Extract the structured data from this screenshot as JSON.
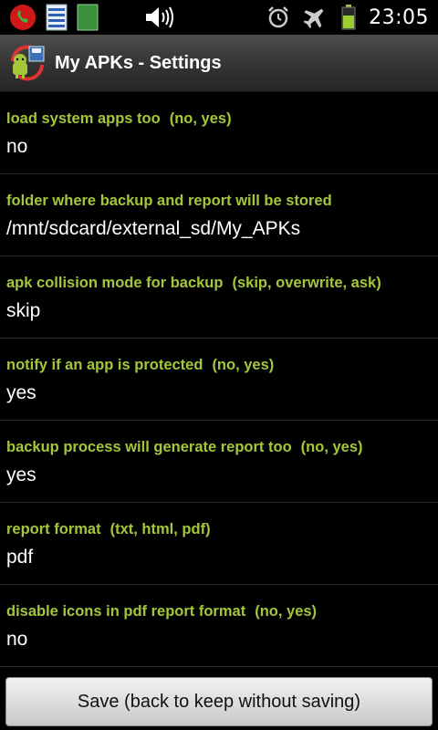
{
  "status_bar": {
    "time": "23:05",
    "icons": [
      "phone-call-icon",
      "document-icon",
      "green-book-icon",
      "volume-icon",
      "alarm-icon",
      "airplane-icon",
      "battery-icon"
    ]
  },
  "app": {
    "title": "My APKs - Settings",
    "icon": "android-backup-icon"
  },
  "settings": [
    {
      "title": "load system apps too",
      "options": "(no, yes)",
      "value": "no"
    },
    {
      "title": "folder where backup and report will be stored",
      "options": "",
      "value": "/mnt/sdcard/external_sd/My_APKs"
    },
    {
      "title": "apk collision mode for backup",
      "options": "(skip, overwrite, ask)",
      "value": "skip"
    },
    {
      "title": "notify if an app is protected",
      "options": "(no, yes)",
      "value": "yes"
    },
    {
      "title": "backup process will generate report too",
      "options": "(no, yes)",
      "value": "yes"
    },
    {
      "title": "report format",
      "options": "(txt, html, pdf)",
      "value": "pdf"
    },
    {
      "title": "disable icons in pdf report format",
      "options": "(no, yes)",
      "value": "no"
    }
  ],
  "save_button": {
    "label": "Save (back to keep without saving)"
  },
  "colors": {
    "accent": "#a4c639",
    "background": "#000000"
  }
}
